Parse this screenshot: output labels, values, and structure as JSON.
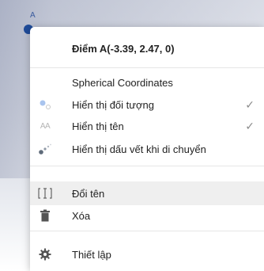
{
  "canvas": {
    "point_label": "A"
  },
  "menu": {
    "title": "Điểm A(-3.39, 2.47, 0)",
    "items": [
      {
        "label": "Spherical Coordinates",
        "icon": "none",
        "checked": false
      },
      {
        "label": "Hiển thị đối tượng",
        "icon": "show-object-icon",
        "checked": true,
        "check": "✓"
      },
      {
        "label": "Hiển thị tên",
        "icon": "show-label-icon",
        "icon_text": "AA",
        "checked": true,
        "check": "✓"
      },
      {
        "label": "Hiển thị dấu vết khi di chuyển",
        "icon": "trace-icon",
        "checked": false
      },
      {
        "label": "Đổi tên",
        "icon": "rename-icon",
        "checked": false
      },
      {
        "label": "Xóa",
        "icon": "trash-icon",
        "checked": false
      },
      {
        "label": "Thiết lập",
        "icon": "settings-gear-icon",
        "checked": false
      }
    ]
  },
  "colors": {
    "point": "#1f4b99",
    "menu_bg": "#ffffff",
    "hover_bg": "#efefef",
    "text": "#222222"
  }
}
